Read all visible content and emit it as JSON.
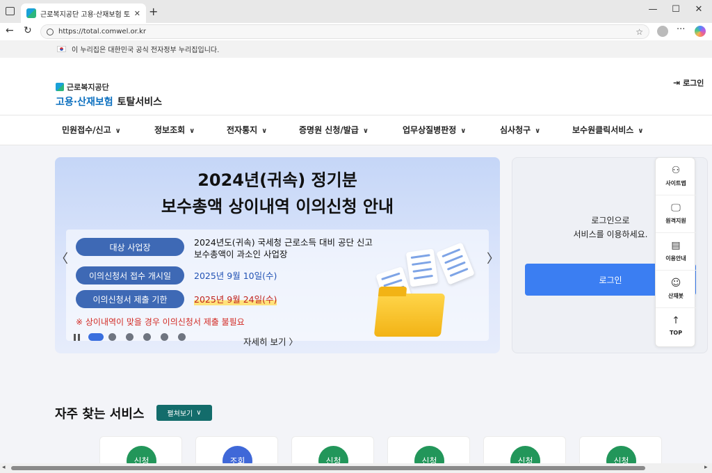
{
  "browser": {
    "tab_title": "근로복지공단 고용·산재보험 토탈",
    "url": "https://total.comwel.or.kr",
    "new_tab": "+",
    "tab_close": "✕",
    "minimize": "—",
    "maximize": "☐",
    "close": "✕"
  },
  "gov_notice": "이 누리집은 대한민국 공식 전자정부 누리집입니다.",
  "logo": {
    "org": "근로복지공단",
    "service_blue": "고용·산재보험",
    "service_dark": "토탈서비스"
  },
  "login_link": "로그인",
  "nav": [
    "민원접수/신고",
    "정보조회",
    "전자통지",
    "증명원 신청/발급",
    "업무상질병판정",
    "심사청구",
    "보수원클릭서비스"
  ],
  "banner": {
    "title_line1": "2024년(귀속) 정기분",
    "title_line2": "보수총액 상이내역  이의신청 안내",
    "rows": [
      {
        "label": "대상 사업장",
        "value1": "2024년도(귀속) 국세청 근로소득 대비 공단 신고",
        "value2": "보수총액이 과소인 사업장"
      },
      {
        "label": "이의신청서 접수 개시일",
        "value": "2025년 9월 10일(수)"
      },
      {
        "label": "이의신청서 제출 기한",
        "value": "2025년 9월 24일(수)"
      }
    ],
    "warning": "※ 상이내역이 맞을 경우 이의신청서 제출 불필요",
    "more": "자세히 보기  〉",
    "slide_count": 6,
    "active_slide": 1
  },
  "login_box": {
    "message_line1": "로그인으로",
    "message_line2": "서비스를 이용하세요.",
    "button": "로그인"
  },
  "quick_menu": [
    {
      "label": "사이트맵",
      "icon": "sitemap-icon",
      "glyph": "⚇"
    },
    {
      "label": "원격지원",
      "icon": "remote-support-icon",
      "glyph": "🖵"
    },
    {
      "label": "이용안내",
      "icon": "guide-icon",
      "glyph": "▤"
    },
    {
      "label": "산재봇",
      "icon": "chatbot-icon",
      "glyph": "☺"
    },
    {
      "label": "TOP",
      "icon": "arrow-up-icon",
      "glyph": "↑"
    }
  ],
  "frequent": {
    "title": "자주 찾는 서비스",
    "fold_button": "펼쳐보기",
    "cards": [
      "신청",
      "조회",
      "신청",
      "신청",
      "신청",
      "신청"
    ]
  },
  "colors": {
    "accent": "#3b7ef2",
    "pill": "#3e69b5",
    "teal": "#136c6b",
    "green_badge": "#22965a"
  }
}
